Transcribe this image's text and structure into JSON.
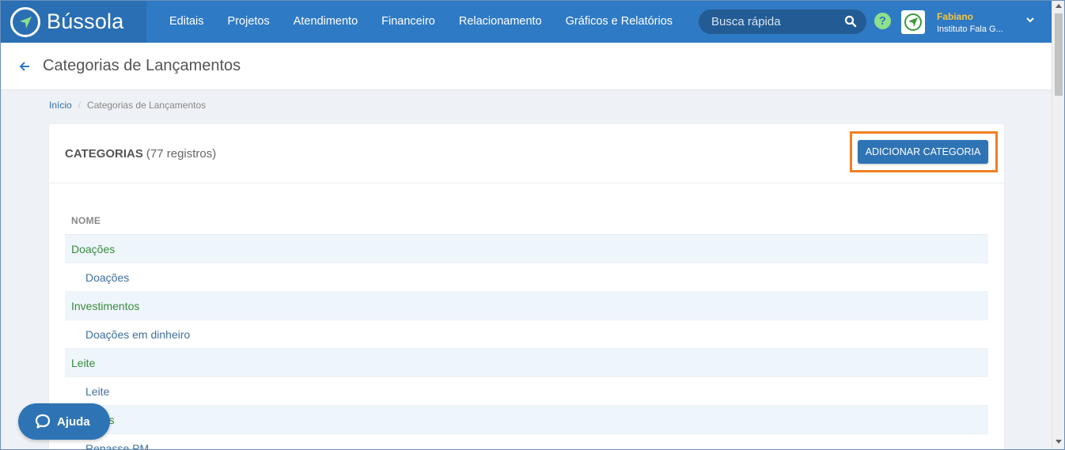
{
  "brand": {
    "name": "Bússola"
  },
  "nav": {
    "items": [
      {
        "label": "Editais"
      },
      {
        "label": "Projetos"
      },
      {
        "label": "Atendimento"
      },
      {
        "label": "Financeiro"
      },
      {
        "label": "Relacionamento"
      },
      {
        "label": "Gráficos e Relatórios"
      }
    ]
  },
  "search": {
    "placeholder": "Busca rápida",
    "value": ""
  },
  "help": {
    "glyph": "?"
  },
  "user": {
    "name": "Fabiano",
    "organization": "Instituto Fala G..."
  },
  "page": {
    "title": "Categorias de Lançamentos"
  },
  "breadcrumb": {
    "home": "Início",
    "separator": "/",
    "current": "Categorias de Lançamentos"
  },
  "card": {
    "title": "CATEGORIAS",
    "count": "(77 registros)",
    "add_button": "ADICIONAR CATEGORIA"
  },
  "table": {
    "header": "NOME",
    "rows": [
      {
        "label": "Doações",
        "level": "parent"
      },
      {
        "label": "Doações",
        "level": "child"
      },
      {
        "label": "Investimentos",
        "level": "parent"
      },
      {
        "label": "Doações em dinheiro",
        "level": "child"
      },
      {
        "label": "Leite",
        "level": "parent"
      },
      {
        "label": "Leite",
        "level": "child"
      },
      {
        "label": "Receitas",
        "level": "parent"
      },
      {
        "label": "Repasse PM",
        "level": "child"
      }
    ]
  },
  "help_widget": {
    "label": "Ajuda"
  },
  "colors": {
    "navbar": "#2f7ac4",
    "brand_bg": "#2a6fb3",
    "accent_button": "#2e74b5",
    "highlight_border": "#f07f22",
    "parent_text": "#3a8a3e",
    "child_text": "#3f6f9e",
    "user_name": "#f5c542"
  }
}
